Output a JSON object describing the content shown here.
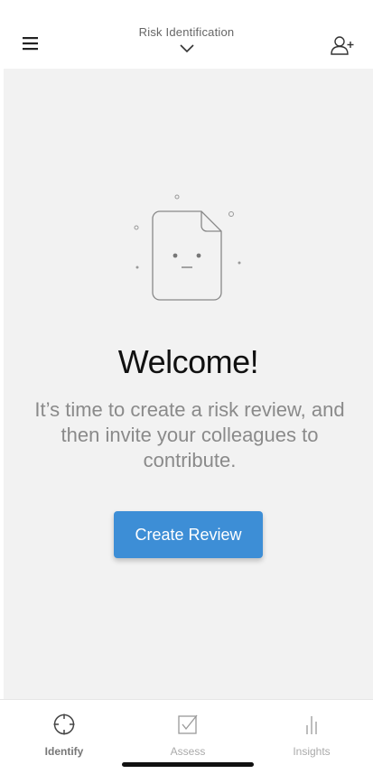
{
  "header": {
    "title": "Risk Identification",
    "menu_icon": "hamburger-menu-icon",
    "invite_icon": "add-user-icon",
    "dropdown_icon": "chevron-down-icon"
  },
  "empty_state": {
    "illustration_icon": "document-face-icon",
    "heading": "Welcome!",
    "message": "It’s time to create a risk review, and then invite your colleagues to contribute.",
    "cta_label": "Create Review"
  },
  "bottom_nav": {
    "tabs": [
      {
        "label": "Identify",
        "icon": "crosshair-icon",
        "active": true
      },
      {
        "label": "Assess",
        "icon": "checkbox-icon",
        "active": false
      },
      {
        "label": "Insights",
        "icon": "bar-chart-icon",
        "active": false
      }
    ]
  },
  "colors": {
    "primary": "#3d8ed6",
    "background": "#f2f2f2",
    "muted_text": "#8a8a8a"
  }
}
